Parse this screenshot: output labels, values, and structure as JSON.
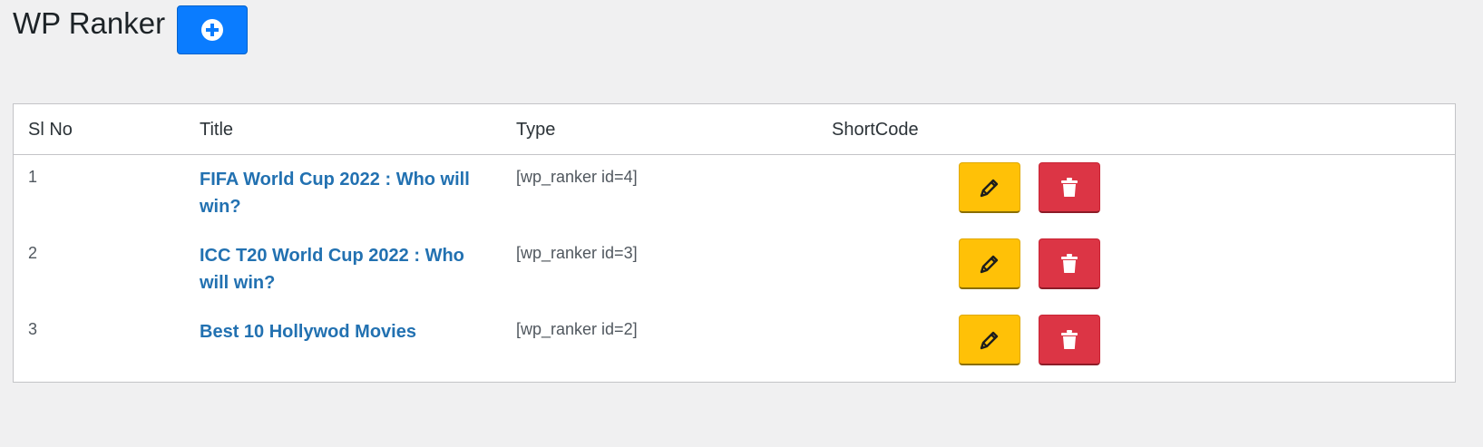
{
  "page": {
    "title": "WP Ranker",
    "add_icon": "plus-circle-icon"
  },
  "table": {
    "headers": {
      "sl_no": "Sl No",
      "title": "Title",
      "type": "Type",
      "shortcode": "ShortCode"
    },
    "rows": [
      {
        "no": "1",
        "title": "FIFA World Cup 2022 : Who will win?",
        "type": "[wp_ranker id=4]"
      },
      {
        "no": "2",
        "title": "ICC T20 World Cup 2022 : Who will win?",
        "type": "[wp_ranker id=3]"
      },
      {
        "no": "3",
        "title": "Best 10 Hollywod Movies",
        "type": "[wp_ranker id=2]"
      }
    ],
    "edit_icon": "pencil-icon",
    "delete_icon": "trash-icon"
  },
  "colors": {
    "background": "#f0f0f1",
    "primary": "#0a7cff",
    "link": "#2271b1",
    "warning": "#ffc107",
    "danger": "#dc3545"
  }
}
